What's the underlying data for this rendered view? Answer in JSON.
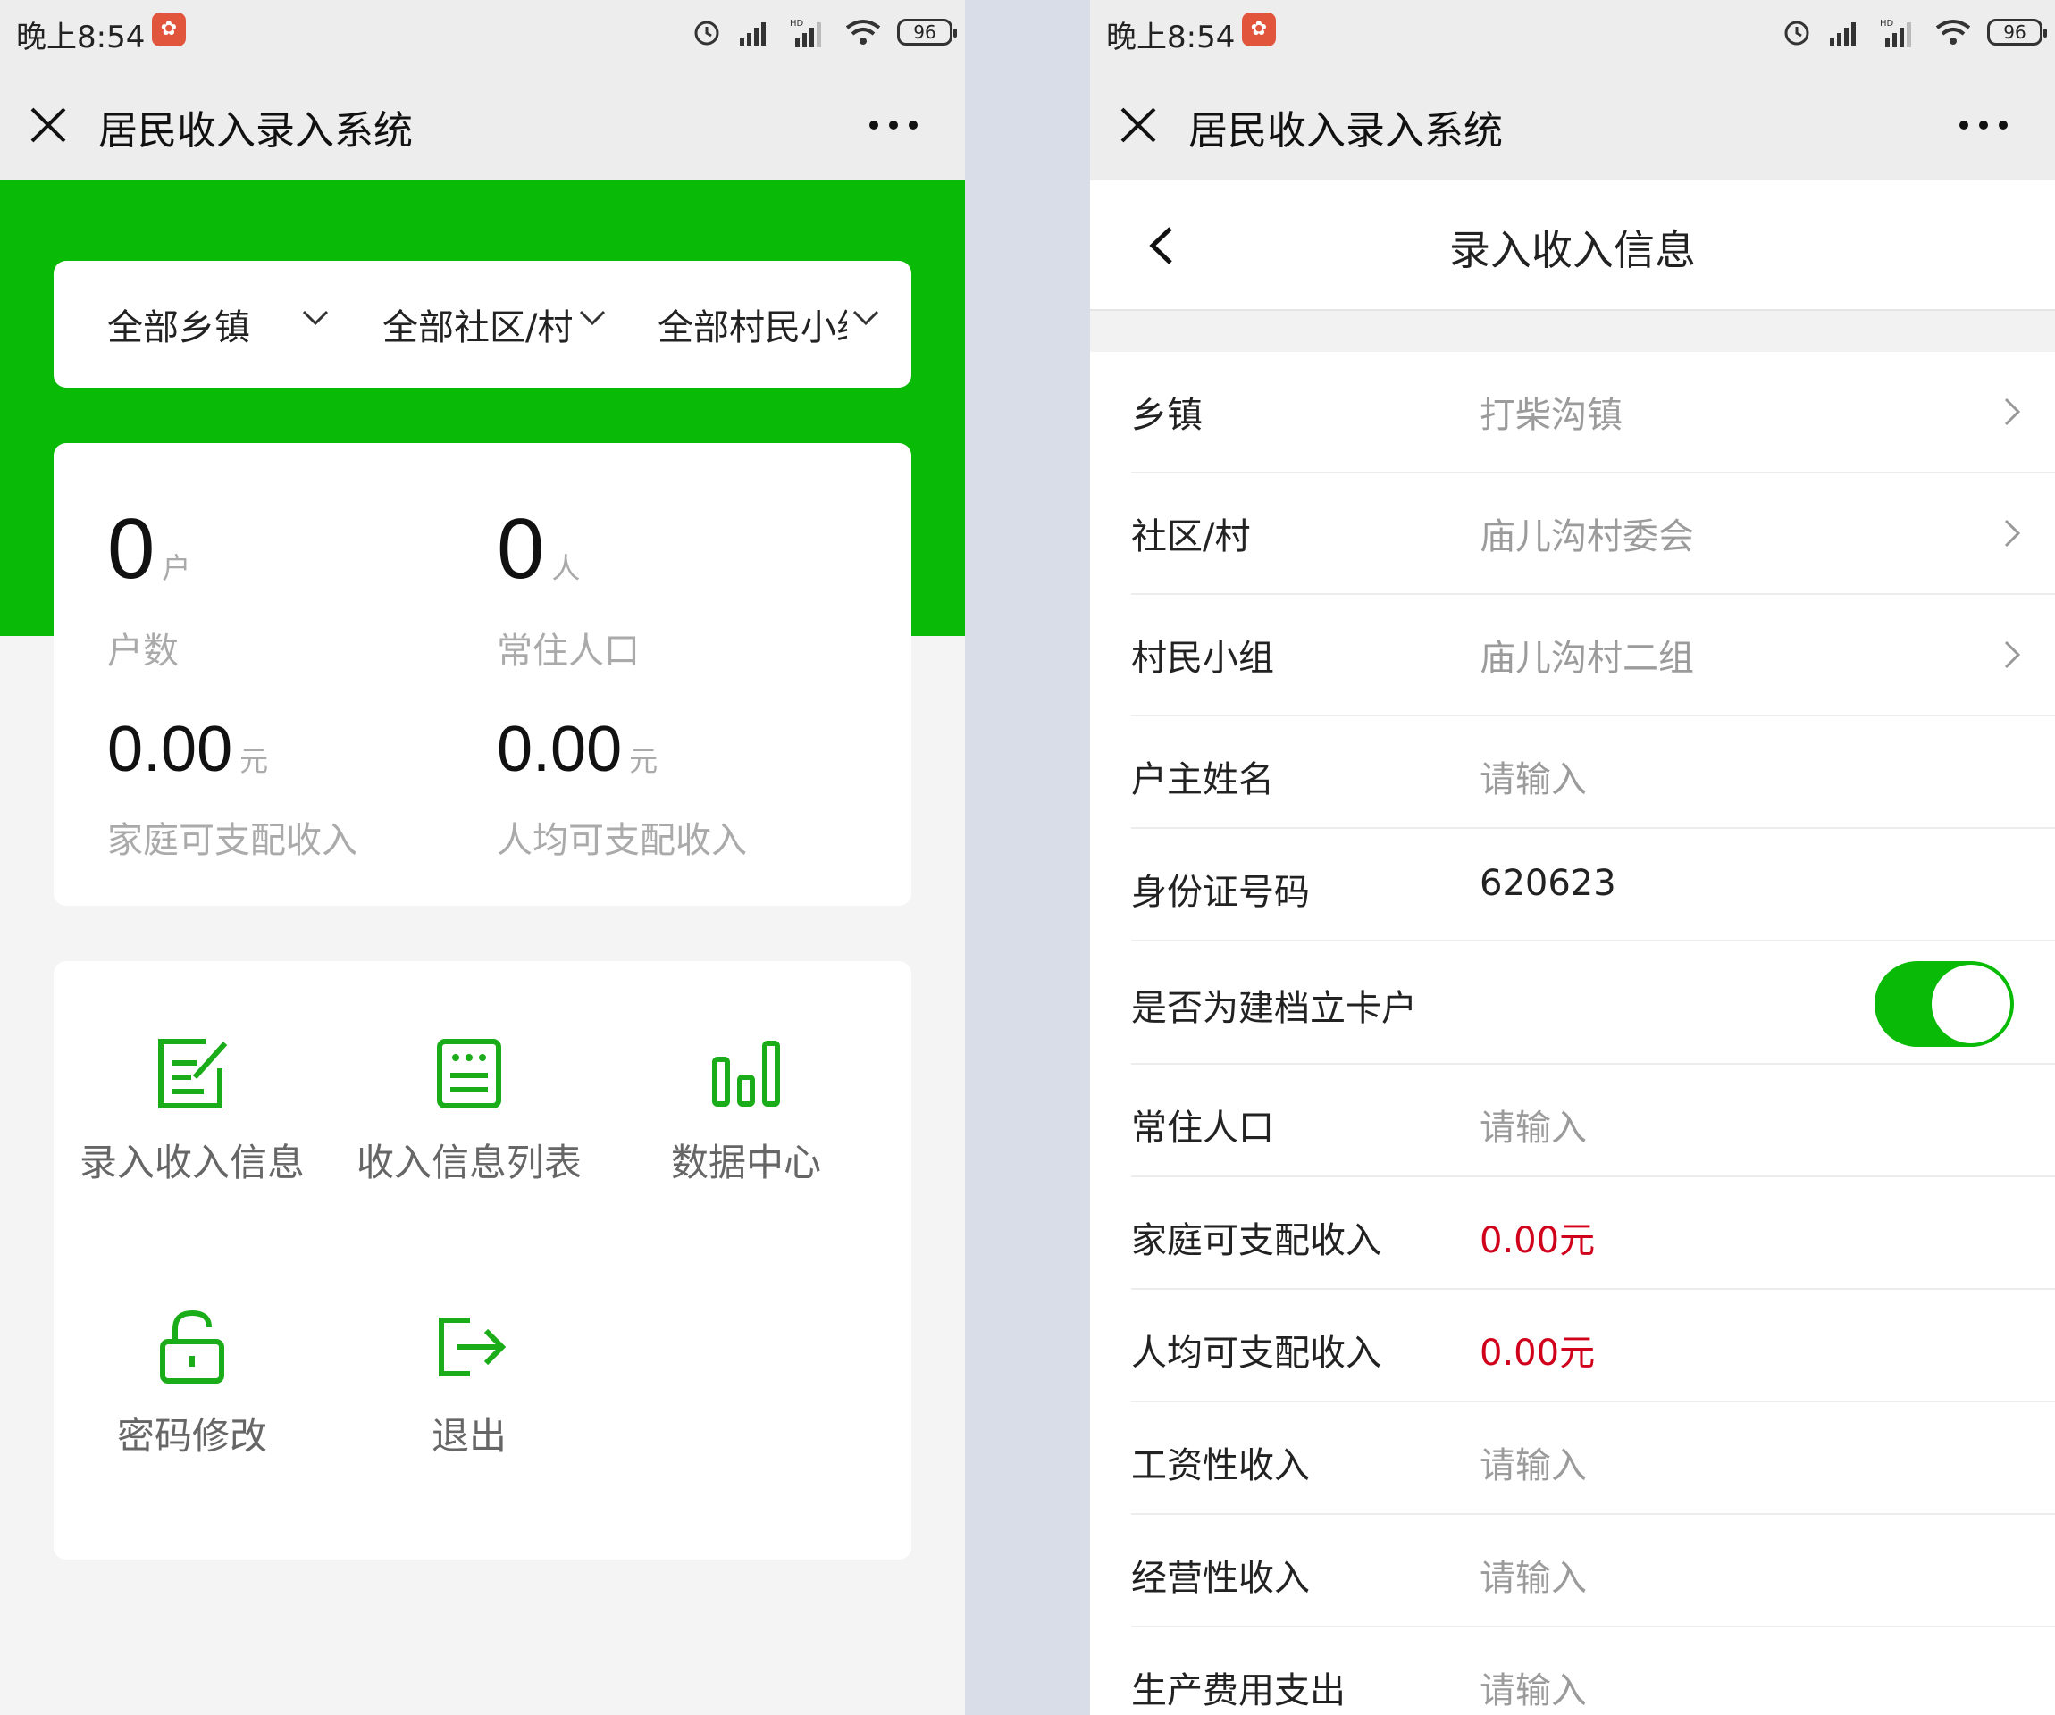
{
  "left": {
    "status": {
      "time": "晚上8:54",
      "battery": "96"
    },
    "app_title": "居民收入录入系统",
    "filters": [
      {
        "label": "全部乡镇"
      },
      {
        "label": "全部社区/村"
      },
      {
        "label": "全部村民小组"
      }
    ],
    "stats": [
      {
        "value": "0",
        "unit": "户",
        "label": "户数"
      },
      {
        "value": "0",
        "unit": "人",
        "label": "常住人口"
      },
      {
        "value": "0.00",
        "unit": "元",
        "label": "家庭可支配收入"
      },
      {
        "value": "0.00",
        "unit": "元",
        "label": "人均可支配收入"
      }
    ],
    "menu": [
      {
        "label": "录入收入信息",
        "icon": "edit-icon"
      },
      {
        "label": "收入信息列表",
        "icon": "list-icon"
      },
      {
        "label": "数据中心",
        "icon": "bar-chart-icon"
      },
      {
        "label": "密码修改",
        "icon": "unlock-icon"
      },
      {
        "label": "退出",
        "icon": "logout-icon"
      }
    ],
    "colors": {
      "brand_green": "#09bb07",
      "icon_green": "#1aad19"
    }
  },
  "right": {
    "status": {
      "time": "晚上8:54",
      "battery": "96"
    },
    "app_title": "居民收入录入系统",
    "page_title": "录入收入信息",
    "fields": [
      {
        "label": "乡镇",
        "value": "打柴沟镇",
        "type": "select"
      },
      {
        "label": "社区/村",
        "value": "庙儿沟村委会",
        "type": "select"
      },
      {
        "label": "村民小组",
        "value": "庙儿沟村二组",
        "type": "select"
      },
      {
        "label": "户主姓名",
        "placeholder": "请输入",
        "type": "input"
      },
      {
        "label": "身份证号码",
        "value": "620623",
        "type": "input"
      },
      {
        "label": "是否为建档立卡户",
        "type": "toggle",
        "checked": true
      },
      {
        "label": "常住人口",
        "placeholder": "请输入",
        "type": "input"
      },
      {
        "label": "家庭可支配收入",
        "value": "0.00元",
        "type": "computed"
      },
      {
        "label": "人均可支配收入",
        "value": "0.00元",
        "type": "computed"
      },
      {
        "label": "工资性收入",
        "placeholder": "请输入",
        "type": "input"
      },
      {
        "label": "经营性收入",
        "placeholder": "请输入",
        "type": "input"
      },
      {
        "label": "生产费用支出",
        "placeholder": "请输入",
        "type": "input"
      }
    ],
    "colors": {
      "toggle_on": "#09bb07",
      "computed_value": "#d0021b"
    }
  }
}
